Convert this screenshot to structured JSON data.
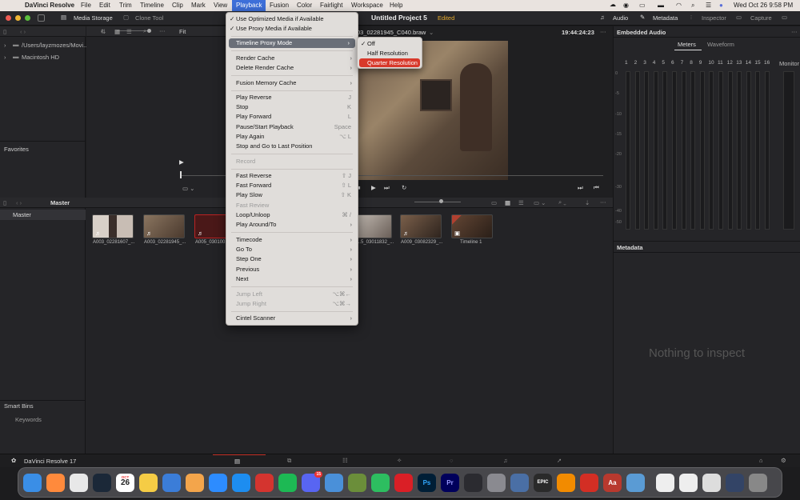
{
  "menubar": {
    "apple": "",
    "app_name": "DaVinci Resolve",
    "items": [
      "File",
      "Edit",
      "Trim",
      "Timeline",
      "Clip",
      "Mark",
      "View",
      "Playback",
      "Fusion",
      "Color",
      "Fairlight",
      "Workspace",
      "Help"
    ],
    "clock": "Wed Oct 26  9:58 PM"
  },
  "appbar": {
    "media_storage": "Media Storage",
    "clone_tool": "Clone Tool",
    "project_title": "Untitled Project 5",
    "edited": "Edited",
    "audio": "Audio",
    "metadata": "Metadata",
    "inspector": "Inspector",
    "capture": "Capture"
  },
  "left": {
    "paths": [
      "/Users/layzmozes/Movi...",
      "Macintosh HD"
    ],
    "favorites": "Favorites",
    "master": "Master",
    "master_item": "Master",
    "smart_bins": "Smart Bins",
    "keywords": "Keywords"
  },
  "viewer": {
    "fit": "Fit",
    "clip_name": "03_02281945_C040.braw",
    "timecode": "19:44:24:23"
  },
  "audio_panel": {
    "title": "Embedded Audio",
    "tab_meters": "Meters",
    "tab_waveform": "Waveform",
    "channels": [
      "1",
      "2",
      "3",
      "4",
      "5",
      "6",
      "7",
      "8",
      "9",
      "10",
      "11",
      "12",
      "13",
      "14",
      "15",
      "16"
    ],
    "monitor": "Monitor",
    "db_scale": [
      "0",
      "-5",
      "-10",
      "-15",
      "-20",
      "-30",
      "-40",
      "-50"
    ]
  },
  "metadata_panel": {
    "title": "Metadata",
    "empty": "Nothing to inspect"
  },
  "clips": [
    {
      "name": "A003_02281607_..."
    },
    {
      "name": "A003_02281945_..."
    },
    {
      "name": "A005_030100..."
    },
    {
      "name": "...5_03011832_..."
    },
    {
      "name": "A009_03082329_..."
    },
    {
      "name": "Timeline 1"
    }
  ],
  "playback_menu": {
    "use_optimized": "Use Optimized Media if Available",
    "use_proxy": "Use Proxy Media if Available",
    "proxy_mode": "Timeline Proxy Mode",
    "render_cache": "Render Cache",
    "delete_render_cache": "Delete Render Cache",
    "fusion_memory": "Fusion Memory Cache",
    "play_reverse": "Play Reverse",
    "play_reverse_sc": "J",
    "stop": "Stop",
    "stop_sc": "K",
    "play_forward": "Play Forward",
    "play_forward_sc": "L",
    "pause_start": "Pause/Start Playback",
    "pause_start_sc": "Space",
    "play_again": "Play Again",
    "play_again_sc": "⌥ L",
    "stop_last": "Stop and Go to Last Position",
    "record": "Record",
    "fast_reverse": "Fast Reverse",
    "fast_reverse_sc": "⇧ J",
    "fast_forward": "Fast Forward",
    "fast_forward_sc": "⇧ L",
    "play_slow": "Play Slow",
    "play_slow_sc": "⇧ K",
    "fast_review": "Fast Review",
    "loop": "Loop/Unloop",
    "loop_sc": "⌘ /",
    "play_around": "Play Around/To",
    "timecode": "Timecode",
    "go_to": "Go To",
    "step_one": "Step One",
    "previous": "Previous",
    "next": "Next",
    "jump_left": "Jump Left",
    "jump_left_sc": "⌥⌘←",
    "jump_right": "Jump Right",
    "jump_right_sc": "⌥⌘→",
    "cintel": "Cintel Scanner"
  },
  "proxy_submenu": {
    "off": "Off",
    "half": "Half Resolution",
    "quarter": "Quarter Resolution"
  },
  "footer": {
    "brand": "DaVinci Resolve 17"
  },
  "dock": {
    "calendar_month": "OCT",
    "calendar_day": "26",
    "badge_discord": "15",
    "icons": [
      "finder-icon",
      "launchpad-icon",
      "chrome-icon",
      "steam-icon",
      "calendar-icon",
      "notes-icon",
      "keynote-icon",
      "pages-icon",
      "zoom-icon",
      "app-store-icon",
      "photo-booth-icon",
      "spotify-icon",
      "discord-icon",
      "stats-icon",
      "minecraft-icon",
      "evernote-icon",
      "creative-cloud-icon",
      "photoshop-icon",
      "premiere-icon",
      "davinci-icon",
      "system-prefs-icon",
      "mission-control-icon",
      "epic-games-icon",
      "vlc-icon",
      "acrobat-icon",
      "dictionary-icon",
      "preview-icon",
      "window-1-icon",
      "window-2-icon",
      "window-3-icon",
      "window-4-icon",
      "trash-icon"
    ],
    "labels": {
      "ps": "Ps",
      "pr": "Pr",
      "epic": "EPIC",
      "aa": "Aa"
    }
  },
  "colors": {
    "accent_orange": "#e5a92b",
    "menu_highlight": "#d8392b",
    "resolve_red": "#c8342b"
  }
}
